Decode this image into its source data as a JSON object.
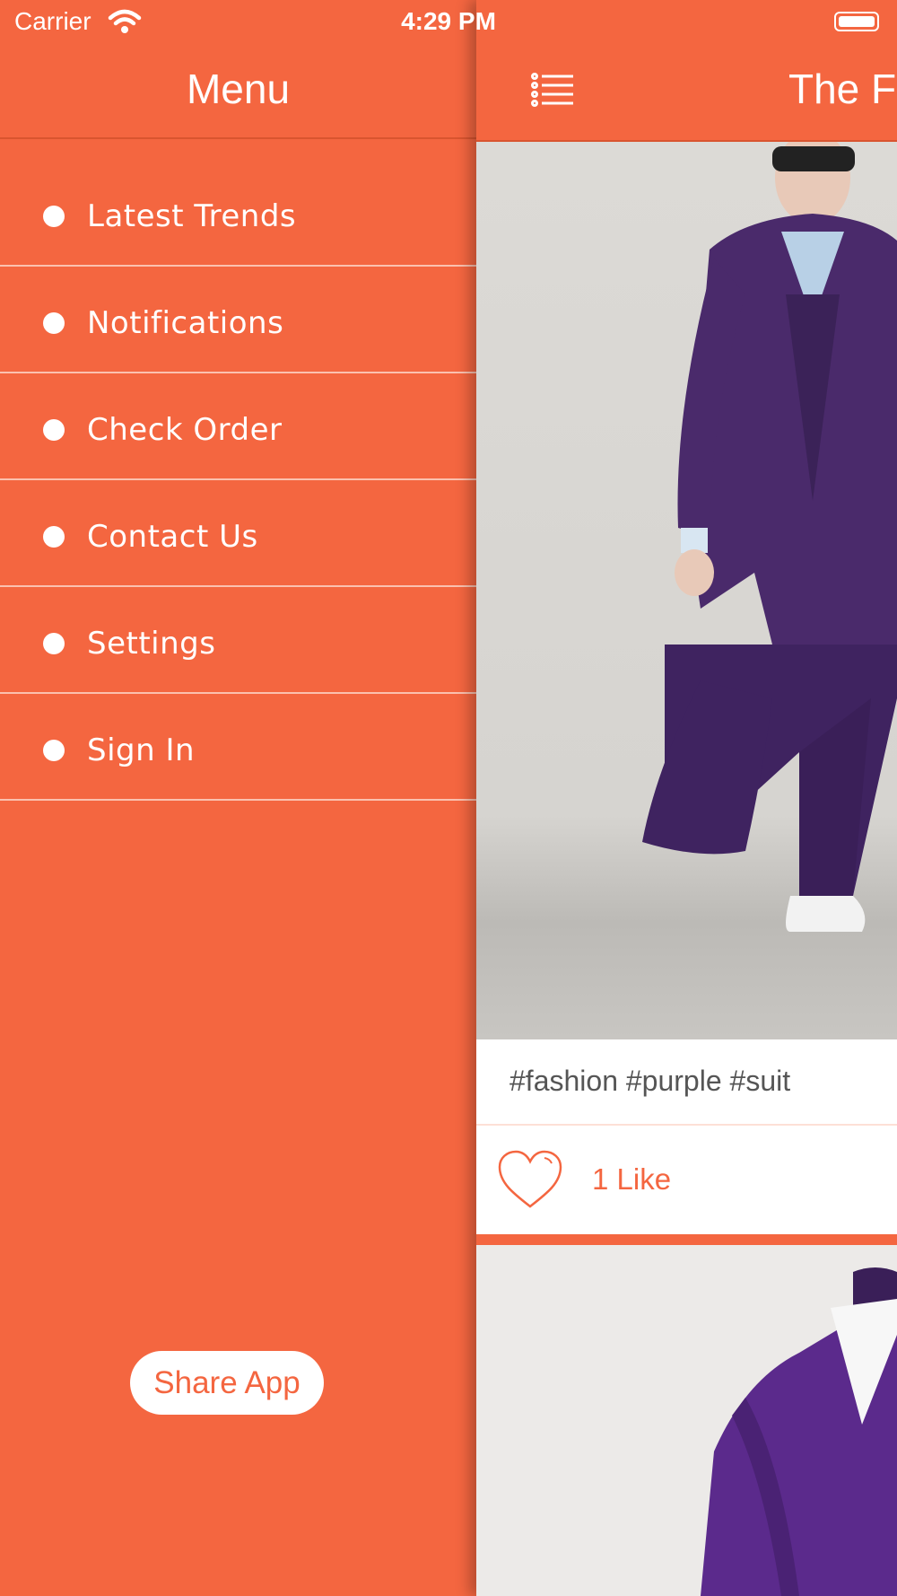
{
  "status_bar": {
    "carrier": "Carrier",
    "time": "4:29 PM"
  },
  "drawer": {
    "title": "Menu",
    "items": [
      {
        "label": "Latest Trends"
      },
      {
        "label": "Notifications"
      },
      {
        "label": "Check Order"
      },
      {
        "label": "Contact Us"
      },
      {
        "label": "Settings"
      },
      {
        "label": "Sign In"
      }
    ],
    "share_label": "Share App"
  },
  "main": {
    "nav_title": "The F",
    "post": {
      "tags": "#fashion #purple #suit",
      "likes": "1 Like"
    }
  },
  "colors": {
    "accent": "#f46640",
    "suit": "#4a2a6b"
  }
}
